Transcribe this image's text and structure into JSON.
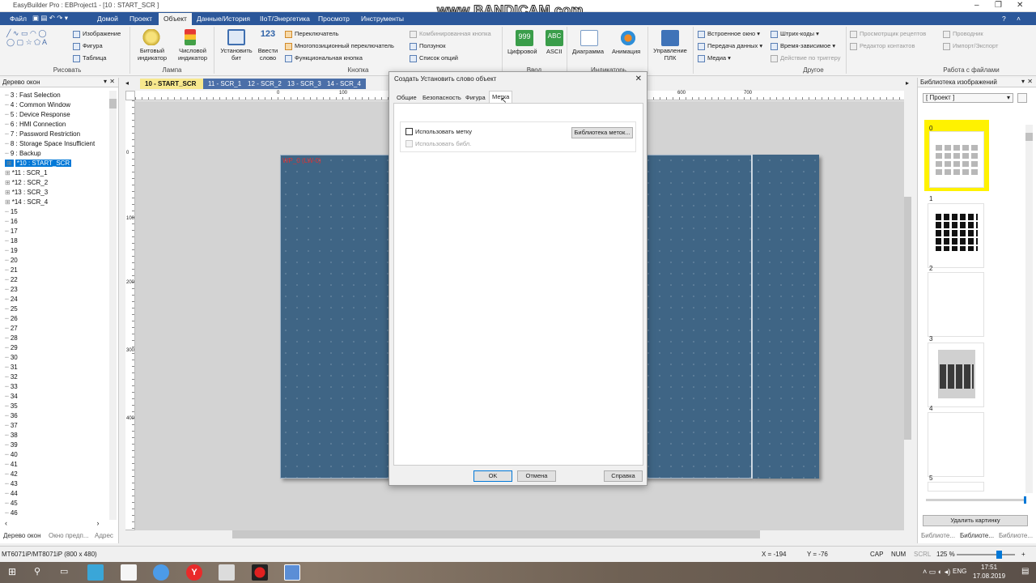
{
  "app": {
    "title": "EasyBuilder Pro : EBProject1 - [10 : START_SCR ]",
    "watermark": "www.BANDICAM.com"
  },
  "menu": [
    "Файл",
    "Домой",
    "Проект",
    "Объект",
    "Данные/История",
    "IIoT/Энергетика",
    "Просмотр",
    "Инструменты"
  ],
  "ribbon": {
    "draw": {
      "image": "Изображение",
      "shape": "Фигура",
      "table": "Таблица",
      "group": "Рисовать"
    },
    "lamp": {
      "bit": "Битовый индикатор",
      "word": "Числовой индикатор",
      "group": "Лампа"
    },
    "button": {
      "set_bit": "Установить бит",
      "set_word": "Ввести слово",
      "toggle": "Переключатель",
      "multistate": "Многопозиционный переключатель",
      "function": "Функциональная кнопка",
      "combo": "Комбинированная кнопка",
      "slider": "Ползунок",
      "option_list": "Список опций",
      "group": "Кнопка"
    },
    "input": {
      "numeric": "Цифровой",
      "ascii": "ASCII",
      "group": "Ввод"
    },
    "indicators": {
      "chart": "Диаграмма",
      "animation": "Анимация",
      "group": "Индикаторы"
    },
    "plc": {
      "label": "Управление ПЛК"
    },
    "other": {
      "embedded": "Встроенное окно",
      "data_transfer": "Передача данных",
      "media": "Медиа",
      "barcode": "Штрих-коды",
      "time": "Время-зависимое",
      "trigger": "Действие по триггеру",
      "group": "Другое"
    },
    "files": {
      "recipe": "Просмотрщик рецептов",
      "contacts": "Редактор контактов",
      "explorer": "Проводник",
      "import": "Импорт/Экспорт",
      "group": "Работа с файлами"
    }
  },
  "left_panel": {
    "title": "Дерево окон",
    "items": [
      {
        "label": "3 : Fast Selection"
      },
      {
        "label": "4 : Common Window"
      },
      {
        "label": "5 : Device Response"
      },
      {
        "label": "6 : HMI Connection"
      },
      {
        "label": "7 : Password Restriction"
      },
      {
        "label": "8 : Storage Space Insufficient"
      },
      {
        "label": "9 : Backup"
      },
      {
        "label": "*10 : START_SCR"
      },
      {
        "label": "*11 : SCR_1"
      },
      {
        "label": "*12 : SCR_2"
      },
      {
        "label": "*13 : SCR_3"
      },
      {
        "label": "*14 : SCR_4"
      },
      {
        "label": "15"
      },
      {
        "label": "16"
      },
      {
        "label": "17"
      },
      {
        "label": "18"
      },
      {
        "label": "19"
      },
      {
        "label": "20"
      },
      {
        "label": "21"
      },
      {
        "label": "22"
      },
      {
        "label": "23"
      },
      {
        "label": "24"
      },
      {
        "label": "25"
      },
      {
        "label": "26"
      },
      {
        "label": "27"
      },
      {
        "label": "28"
      },
      {
        "label": "29"
      },
      {
        "label": "30"
      },
      {
        "label": "31"
      },
      {
        "label": "32"
      },
      {
        "label": "33"
      },
      {
        "label": "34"
      },
      {
        "label": "35"
      },
      {
        "label": "36"
      },
      {
        "label": "37"
      },
      {
        "label": "38"
      },
      {
        "label": "39"
      },
      {
        "label": "40"
      },
      {
        "label": "41"
      },
      {
        "label": "42"
      },
      {
        "label": "43"
      },
      {
        "label": "44"
      },
      {
        "label": "45"
      },
      {
        "label": "46"
      }
    ],
    "bottom_tabs": [
      "Дерево окон",
      "Окно предп...",
      "Адрес"
    ]
  },
  "doc_tabs": [
    "10 - START_SCR",
    "11 - SCR_1",
    "12 - SCR_2",
    "13 - SCR_3",
    "14 - SCR_4"
  ],
  "ruler": {
    "h": [
      "0",
      "100",
      "600",
      "700"
    ],
    "v": [
      "0",
      "100",
      "200",
      "300",
      "400"
    ]
  },
  "canvas": {
    "object_label": "WP_0 (LW-0)"
  },
  "dialog": {
    "title": "Создать Установить слово объект",
    "tabs": [
      "Общие",
      "Безопасность",
      "Фигура",
      "Метка"
    ],
    "use_label": "Использовать метку",
    "use_library": "Использовать библ.",
    "library_button": "Библиотека меток...",
    "ok": "OK",
    "cancel": "Отмена",
    "help": "Справка"
  },
  "right_panel": {
    "title": "Библиотека изображений",
    "dropdown": "[ Проект ]",
    "thumb_numbers": [
      "0",
      "1",
      "2",
      "3",
      "4",
      "5"
    ],
    "delete_button": "Удалить картинку",
    "bottom_tabs": [
      "Библиоте...",
      "Библиоте...",
      "Библиоте..."
    ]
  },
  "status": {
    "model": "MT6071iP/MT8071iP (800 x 480)",
    "x": "X = -194",
    "y": "Y = -76",
    "cap": "CAP",
    "num": "NUM",
    "scrl": "SCRL",
    "zoom": "125 %"
  },
  "taskbar": {
    "lang": "ENG",
    "time": "17:51",
    "date": "17.08.2019"
  }
}
